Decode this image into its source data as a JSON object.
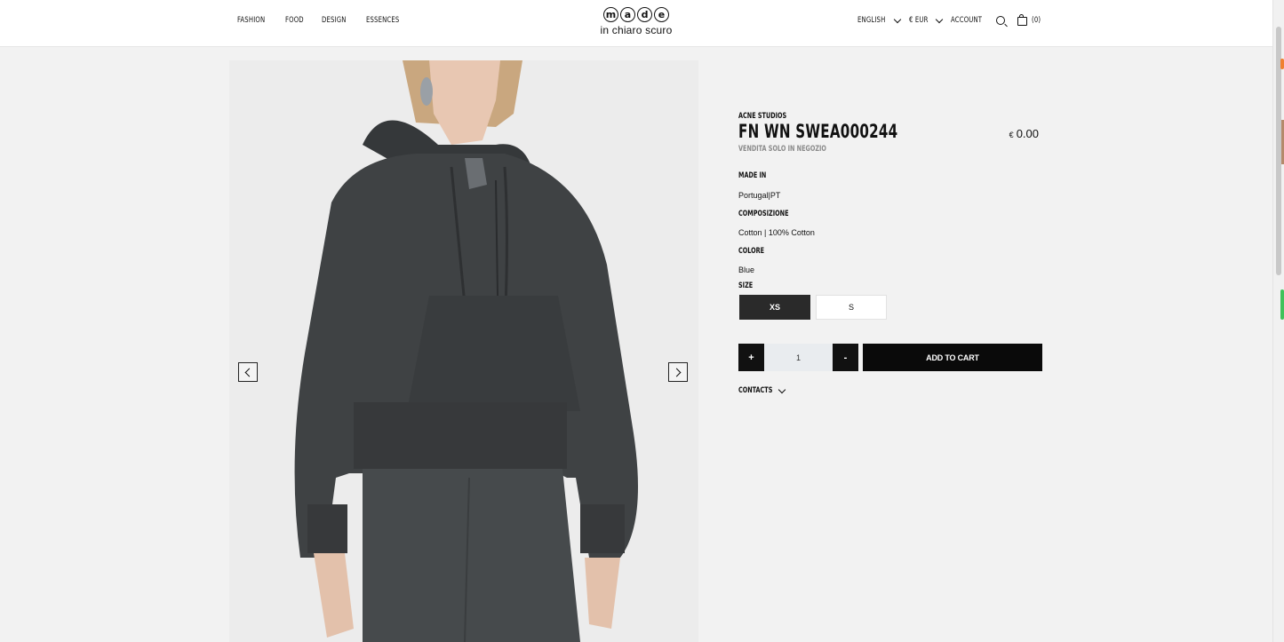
{
  "nav": {
    "left": [
      "FASHION",
      "FOOD",
      "DESIGN",
      "ESSENCES"
    ],
    "language": "ENGLISH",
    "currency": "€ EUR",
    "account": "ACCOUNT",
    "cart_count": "(0)"
  },
  "logo": {
    "letters": [
      "m",
      "a",
      "d",
      "e"
    ],
    "tagline": "in chiaro scuro"
  },
  "product": {
    "brand": "ACNE STUDIOS",
    "name": "FN WN SWEA000244",
    "note": "VENDITA SOLO IN NEGOZIO",
    "currency_symbol": "€",
    "price": "0.00",
    "made_in_label": "MADE IN",
    "made_in_value": "Portugal|PT",
    "composition_label": "COMPOSIZIONE",
    "composition_value": "Cotton | 100% Cotton",
    "color_label": "COLORE",
    "color_value": "Blue",
    "size_label": "SIZE",
    "sizes": [
      "XS",
      "S"
    ],
    "selected_size": "XS",
    "quantity": "1",
    "plus_label": "+",
    "minus_label": "-",
    "add_to_cart": "ADD TO CART",
    "contacts": "CONTACTS"
  },
  "colors": {
    "primary": "#111111",
    "page_bg": "#f2f2f2",
    "garment": "#3f4244"
  }
}
